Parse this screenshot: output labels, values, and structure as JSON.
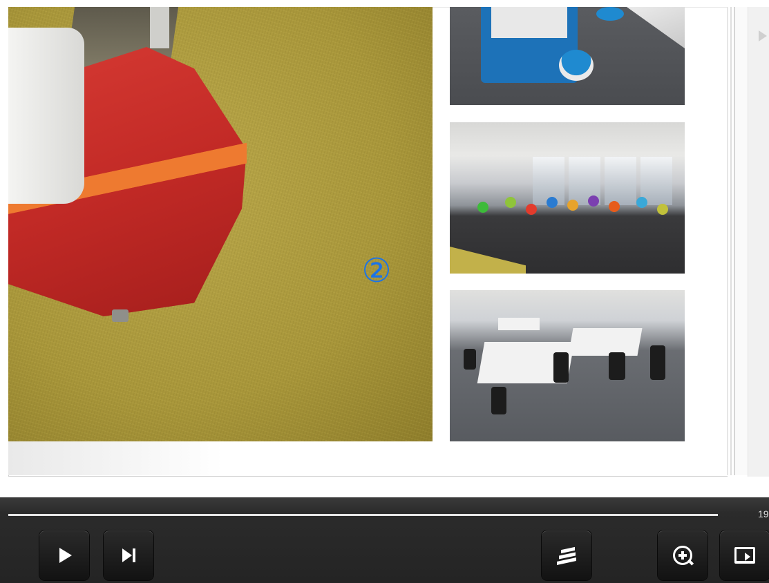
{
  "page_marker": "②",
  "player": {
    "page_number": "19",
    "buttons": {
      "play": "play",
      "next": "next",
      "toc": "table-of-contents",
      "zoom": "zoom-in",
      "slideshow": "book"
    }
  },
  "colors": {
    "marker": "#1a73e8",
    "control_bar": "#242424",
    "progress": "#e6e6e6"
  }
}
